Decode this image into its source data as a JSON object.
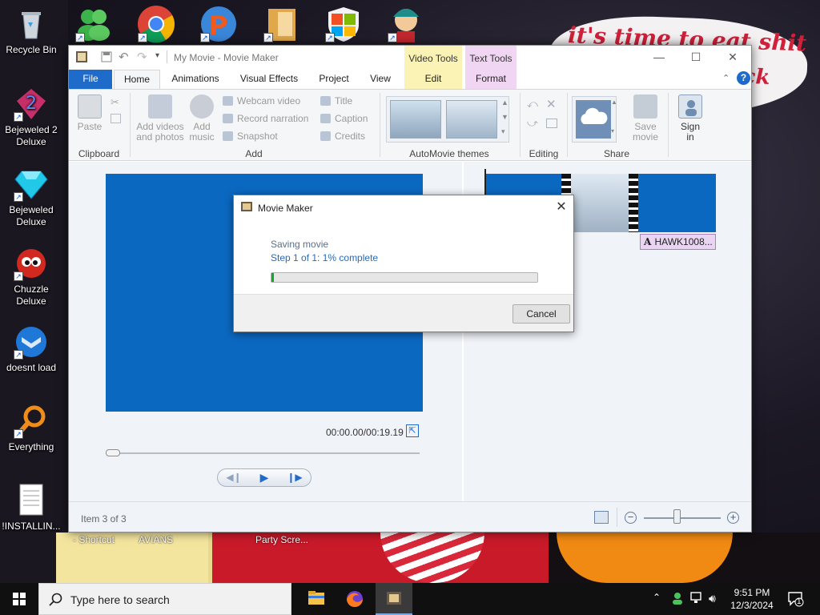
{
  "desktop": {
    "icons": [
      {
        "label": "Recycle Bin"
      },
      {
        "label": "Bejeweled 2 Deluxe"
      },
      {
        "label": "Bejeweled Deluxe"
      },
      {
        "label": "Chuzzle Deluxe"
      },
      {
        "label": "doesnt load"
      },
      {
        "label": "Everything"
      },
      {
        "label": "!INSTALLIN..."
      }
    ],
    "wallpaper_text": {
      "line1": "it's time to eat shit",
      "line2": "ck"
    },
    "bottom_labels": [
      "- Shortcut",
      "AVIANS",
      "Party Scre..."
    ]
  },
  "window": {
    "title": "My Movie - Movie Maker",
    "context_tabs": {
      "video_tools": "Video Tools",
      "text_tools": "Text Tools"
    },
    "tabs": [
      "File",
      "Home",
      "Animations",
      "Visual Effects",
      "Project",
      "View",
      "Edit",
      "Format"
    ],
    "ribbon": {
      "clipboard": {
        "paste": "Paste",
        "group": "Clipboard"
      },
      "add": {
        "add_videos": "Add videos",
        "add_videos2": "and photos",
        "add_music": "Add",
        "add_music2": "music",
        "webcam": "Webcam video",
        "narration": "Record narration",
        "snapshot": "Snapshot",
        "title": "Title",
        "caption": "Caption",
        "credits": "Credits",
        "group": "Add"
      },
      "themes": {
        "group": "AutoMovie themes"
      },
      "editing": {
        "group": "Editing"
      },
      "share": {
        "save_movie": "Save",
        "save_movie2": "movie",
        "group": "Share"
      },
      "sign_in": {
        "line1": "Sign",
        "line2": "in"
      }
    },
    "preview": {
      "timecode": "00:00.00/00:19.19"
    },
    "storyboard": {
      "caption_item": "HAWK1008..."
    },
    "status": {
      "item_count": "Item 3 of 3"
    }
  },
  "dialog": {
    "title": "Movie Maker",
    "message": "Saving movie",
    "progress_text": "Step 1 of 1: 1% complete",
    "progress_fraction": 0.01,
    "cancel": "Cancel",
    "close": "✕"
  },
  "taskbar": {
    "search_placeholder": "Type here to search",
    "time": "9:51 PM",
    "date": "12/3/2024",
    "notification_count": "1"
  },
  "colors": {
    "accent": "#1e6bc9",
    "progress": "#06b025",
    "video_tools_tab": "#fbf3b5",
    "text_tools_tab": "#f1d6f3",
    "preview_blue": "#0b68c1"
  }
}
